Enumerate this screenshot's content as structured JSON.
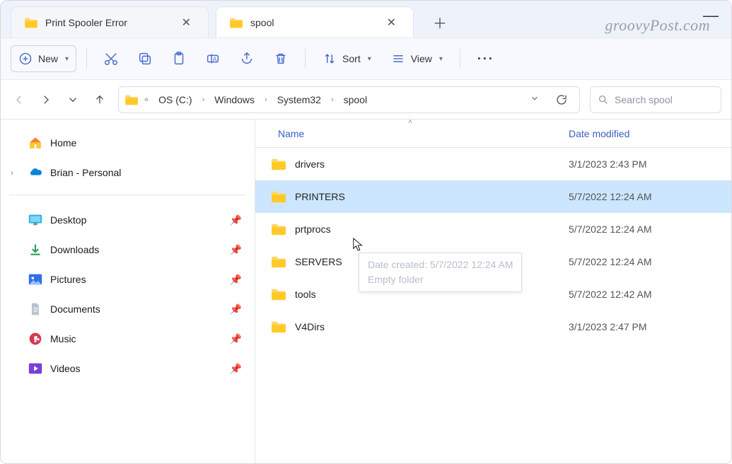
{
  "tabs": [
    {
      "title": "Print Spooler Error",
      "active": false
    },
    {
      "title": "spool",
      "active": true
    }
  ],
  "watermark": "groovyPost.com",
  "toolbar": {
    "new_label": "New",
    "sort_label": "Sort",
    "view_label": "View"
  },
  "breadcrumb": {
    "segments": [
      "OS (C:)",
      "Windows",
      "System32",
      "spool"
    ]
  },
  "search": {
    "placeholder": "Search spool"
  },
  "sidebar": {
    "top": [
      {
        "label": "Home",
        "icon": "home"
      },
      {
        "label": "Brian - Personal",
        "icon": "onedrive",
        "expandable": true
      }
    ],
    "quick": [
      {
        "label": "Desktop",
        "icon": "desktop"
      },
      {
        "label": "Downloads",
        "icon": "downloads"
      },
      {
        "label": "Pictures",
        "icon": "pictures"
      },
      {
        "label": "Documents",
        "icon": "documents"
      },
      {
        "label": "Music",
        "icon": "music"
      },
      {
        "label": "Videos",
        "icon": "videos"
      }
    ]
  },
  "columns": {
    "name": "Name",
    "date": "Date modified"
  },
  "files": [
    {
      "name": "drivers",
      "date": "3/1/2023 2:43 PM",
      "selected": false
    },
    {
      "name": "PRINTERS",
      "date": "5/7/2022 12:24 AM",
      "selected": true
    },
    {
      "name": "prtprocs",
      "date": "5/7/2022 12:24 AM",
      "selected": false
    },
    {
      "name": "SERVERS",
      "date": "5/7/2022 12:24 AM",
      "selected": false
    },
    {
      "name": "tools",
      "date": "5/7/2022 12:42 AM",
      "selected": false
    },
    {
      "name": "V4Dirs",
      "date": "3/1/2023 2:47 PM",
      "selected": false
    }
  ],
  "tooltip": {
    "line1": "Date created: 5/7/2022 12:24 AM",
    "line2": "Empty folder"
  }
}
